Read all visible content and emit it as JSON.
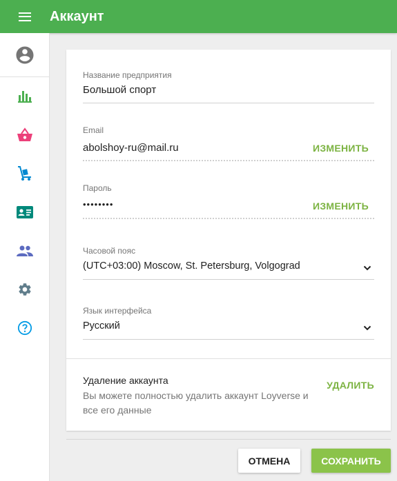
{
  "header": {
    "title": "Аккаунт",
    "menu_icon": "hamburger-icon"
  },
  "sidebar": {
    "avatar_icon": "account-circle-icon",
    "items": [
      {
        "icon": "bar-chart-icon",
        "color": "#4caf50"
      },
      {
        "icon": "shopping-basket-icon",
        "color": "#ec407a"
      },
      {
        "icon": "hand-truck-icon",
        "color": "#0288d1"
      },
      {
        "icon": "id-card-icon",
        "color": "#00897b"
      },
      {
        "icon": "people-icon",
        "color": "#5c6bc0"
      },
      {
        "icon": "gear-icon",
        "color": "#607d8b"
      },
      {
        "icon": "help-circle-icon",
        "color": "#039be5"
      }
    ]
  },
  "form": {
    "company": {
      "label": "Название предприятия",
      "value": "Большой спорт"
    },
    "email": {
      "label": "Email",
      "value": "abolshoy-ru@mail.ru",
      "action": "ИЗМЕНИТЬ"
    },
    "password": {
      "label": "Пароль",
      "value": "••••••••",
      "action": "ИЗМЕНИТЬ"
    },
    "timezone": {
      "label": "Часовой пояс",
      "value": "(UTC+03:00) Moscow, St. Petersburg, Volgograd"
    },
    "language": {
      "label": "Язык интерфейса",
      "value": "Русский"
    },
    "delete": {
      "title": "Удаление аккаунта",
      "description": "Вы можете полностью удалить аккаунт Loyverse и все его данные",
      "action": "УДАЛИТЬ"
    }
  },
  "footer": {
    "cancel_label": "ОТМЕНА",
    "save_label": "СОХРАНИТЬ"
  },
  "colors": {
    "primary": "#4caf50",
    "accent": "#8bc34a",
    "link": "#7cb342"
  }
}
